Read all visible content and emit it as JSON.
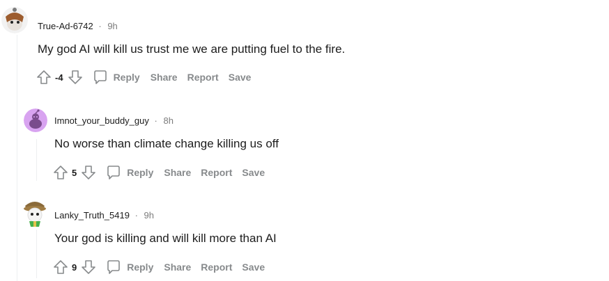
{
  "comments": [
    {
      "username": "True-Ad-6742",
      "separator": "·",
      "age": "9h",
      "text": "My god AI will kill us trust me we are putting fuel to the fire.",
      "score": "-4",
      "reply_label": "Reply",
      "share_label": "Share",
      "report_label": "Report",
      "save_label": "Save"
    },
    {
      "username": "Imnot_your_buddy_guy",
      "separator": "·",
      "age": "8h",
      "text": "No worse than climate change killing us off",
      "score": "5",
      "reply_label": "Reply",
      "share_label": "Share",
      "report_label": "Report",
      "save_label": "Save"
    },
    {
      "username": "Lanky_Truth_5419",
      "separator": "·",
      "age": "9h",
      "text": "Your god is killing and will kill more than AI",
      "score": "9",
      "reply_label": "Reply",
      "share_label": "Share",
      "report_label": "Report",
      "save_label": "Save"
    }
  ],
  "colors": {
    "text": "#1c1c1c",
    "muted": "#878a8c",
    "avatar_purple": "#d8a3f0",
    "thread_line": "#edeff1"
  },
  "icons": [
    "upvote-icon",
    "downvote-icon",
    "comment-bubble-icon"
  ]
}
